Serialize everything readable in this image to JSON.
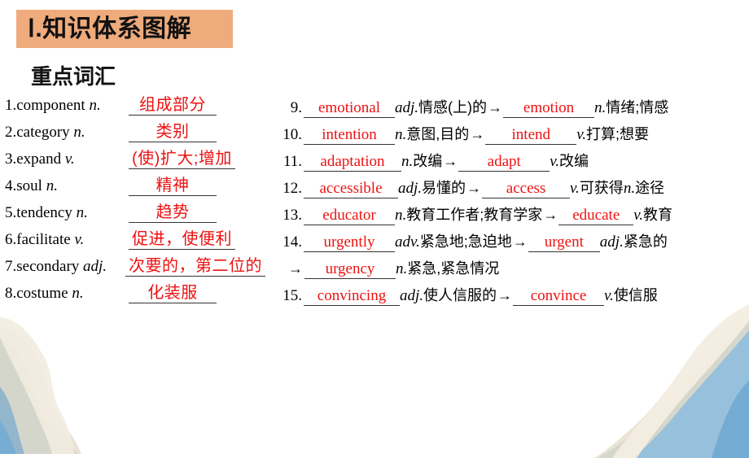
{
  "header": {
    "banner_title": "Ⅰ.知识体系图解",
    "banner_color": "#efab7c",
    "subtitle": "重点词汇",
    "answer_color": "#ee1111"
  },
  "left_column": [
    {
      "num": "1.",
      "word": "component",
      "pos": "n.",
      "answer": "组成部分"
    },
    {
      "num": "2.",
      "word": "category",
      "pos": "n.",
      "answer": "类别"
    },
    {
      "num": "3.",
      "word": "expand",
      "pos": "v.",
      "answer": "(使)扩大;增加"
    },
    {
      "num": "4.",
      "word": "soul",
      "pos": "n.",
      "answer": "精神"
    },
    {
      "num": "5.",
      "word": "tendency",
      "pos": "n.",
      "answer": "趋势"
    },
    {
      "num": "6.",
      "word": "facilitate",
      "pos": "v.",
      "answer": "促进，使便利"
    },
    {
      "num": "7.",
      "word": "secondary",
      "pos": "adj.",
      "answer": "次要的，第二位的"
    },
    {
      "num": "8.",
      "word": "costume",
      "pos": "n.",
      "answer": "化装服"
    }
  ],
  "right_column": [
    {
      "num": "9.",
      "answer1": "emotional",
      "pos1": "adj.",
      "gloss1": "情感(上)的",
      "arrow": "→",
      "answer2": "emotion",
      "pos2": "n.",
      "gloss2": "情绪;情感"
    },
    {
      "num": "10.",
      "answer1": "intention",
      "pos1": "n.",
      "gloss1": "意图,目的",
      "arrow": "→",
      "answer2": "intend",
      "pos2": "v.",
      "gloss2": "打算;想要"
    },
    {
      "num": "11.",
      "answer1": "adaptation",
      "pos1": "n.",
      "gloss1": "改编",
      "arrow": "→",
      "answer2": "adapt",
      "pos2": "v.",
      "gloss2": "改编"
    },
    {
      "num": "12.",
      "answer1": "accessible",
      "pos1": "adj.",
      "gloss1": "易懂的",
      "arrow": "→",
      "answer2": "access",
      "pos2": "v.",
      "gloss2": "可获得",
      "pos3": "n.",
      "gloss3": "途径"
    },
    {
      "num": "13.",
      "answer1": "educator",
      "pos1": "n.",
      "gloss1": "教育工作者;教育学家",
      "arrow": "→",
      "answer2": "educate",
      "pos2": "v.",
      "gloss2": "教育"
    },
    {
      "num": "14.",
      "answer1": "urgently",
      "pos1": "adv.",
      "gloss1": "紧急地;急迫地",
      "arrow": "→",
      "answer2": "urgent",
      "pos2": "adj.",
      "gloss2": "紧急的"
    },
    {
      "num": "→",
      "answer1": "urgency",
      "pos1": "n.",
      "gloss1": "紧急,紧急情况",
      "continuation": true
    },
    {
      "num": "15.",
      "answer1": "convincing",
      "pos1": "adj.",
      "gloss1": "使人信服的",
      "arrow": "→",
      "answer2": "convince",
      "pos2": "v.",
      "gloss2": "使信服"
    }
  ]
}
